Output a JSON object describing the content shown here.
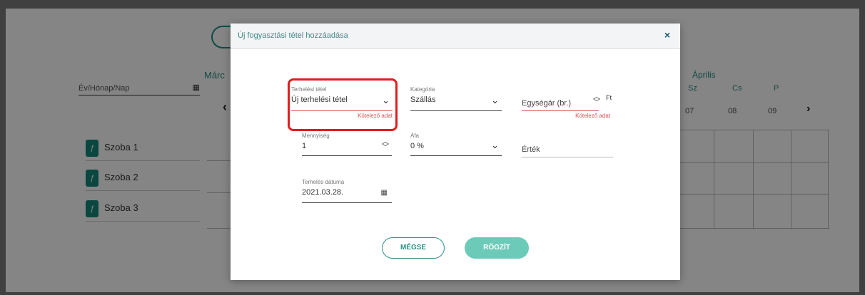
{
  "background": {
    "date_picker_label": "Év/Hónap/Nap",
    "month_left": "Márc",
    "month_right": "Április",
    "day_names": [
      "Sz",
      "Cs",
      "P"
    ],
    "day_numbers": [
      "07",
      "08",
      "09"
    ],
    "rooms": [
      {
        "label": "Szoba 1",
        "icon": "key-icon"
      },
      {
        "label": "Szoba 2",
        "icon": "key-icon"
      },
      {
        "label": "Szoba 3",
        "icon": "key-icon"
      }
    ]
  },
  "modal": {
    "title": "Új fogyasztási tétel hozzáadása",
    "close_symbol": "×",
    "fields": {
      "charge_item": {
        "label": "Terhelési tétel",
        "value": "Új terhelési tétel",
        "error": "Kötelező adat"
      },
      "category": {
        "label": "Kategória",
        "value": "Szállás"
      },
      "unit_price": {
        "placeholder": "Egységár (br.)",
        "unit": "Ft",
        "error": "Kötelező adat"
      },
      "quantity": {
        "label": "Mennyiség",
        "value": "1"
      },
      "vat": {
        "label": "Áfa",
        "value": "0 %"
      },
      "amount": {
        "placeholder": "Érték"
      },
      "charge_date": {
        "label": "Terhelés dátuma",
        "value": "2021.03.28."
      }
    },
    "buttons": {
      "cancel": "MÉGSE",
      "save": "RÖGZÍT"
    }
  },
  "colors": {
    "accent": "#2a9287",
    "accent_light": "#6ccab8",
    "error": "#e05050",
    "highlight": "#e01d1d"
  }
}
